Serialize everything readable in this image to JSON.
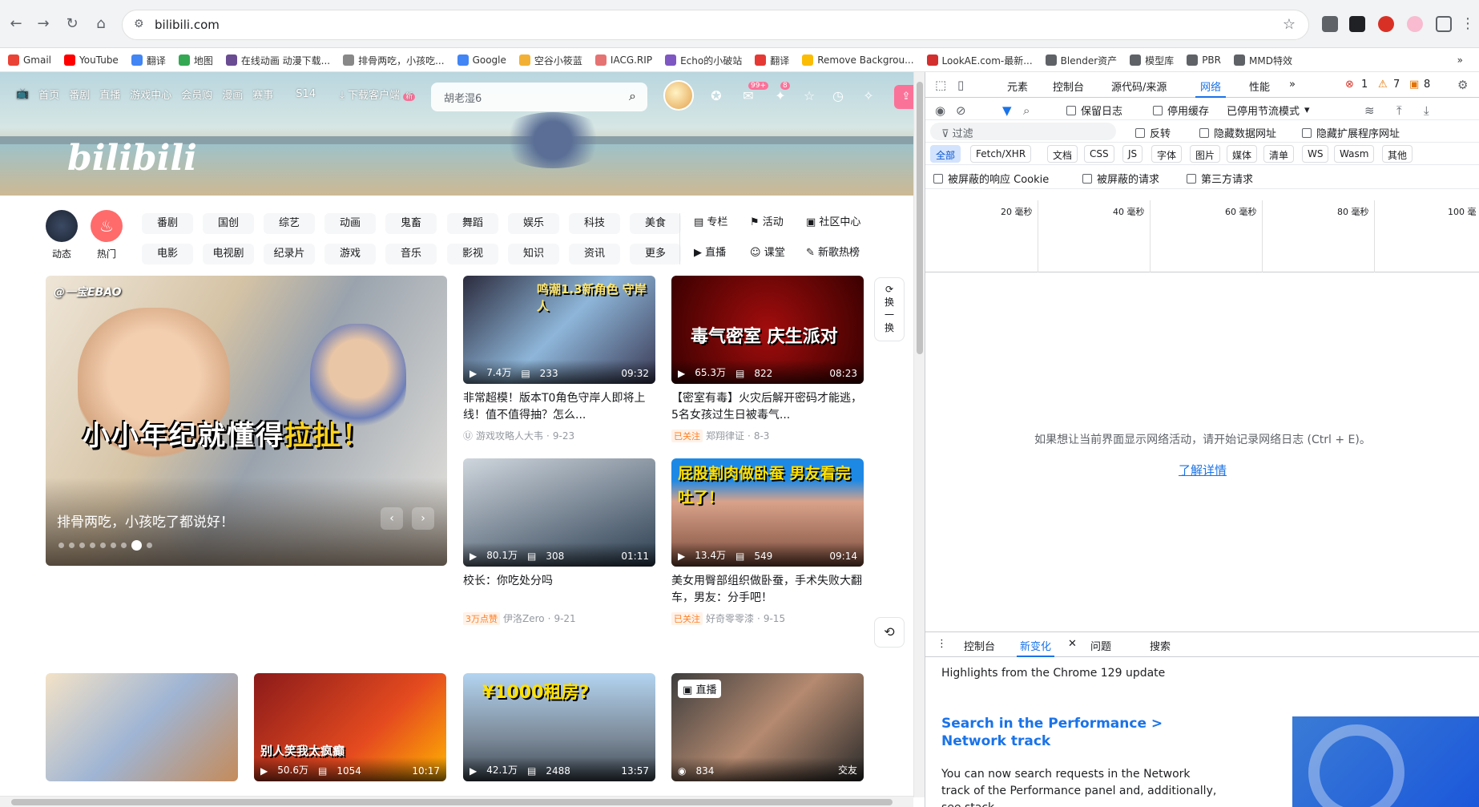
{
  "browser": {
    "url": "bilibili.com",
    "bookmarks": [
      "Gmail",
      "YouTube",
      "翻译",
      "地图",
      "在线动画 动漫下载...",
      "排骨两吃，小孩吃...",
      "Google",
      "空谷小筱蓝",
      "IACG.RIP",
      "Echo的小破站",
      "翻译",
      "Remove Backgrou...",
      "LookAE.com-最新...",
      "Blender资产",
      "模型库",
      "PBR",
      "MMD特效"
    ],
    "bookmark_colors": [
      "#ea4335",
      "#ff0000",
      "#4285f4",
      "#34a853",
      "#6a4c93",
      "#888888",
      "#4285f4",
      "#f2b134",
      "#e57373",
      "#7e57c2",
      "#e53935",
      "#fbbc04",
      "#d32f2f",
      "#5f6368",
      "#5f6368",
      "#5f6368",
      "#5f6368"
    ],
    "more_bookmarks": "»"
  },
  "header": {
    "nav": [
      "首页",
      "番剧",
      "直播",
      "游戏中心",
      "会员购",
      "漫画",
      "赛事"
    ],
    "s14": "S14",
    "download": "下载客户端",
    "new_tag": "新",
    "search_placeholder": "胡老湿6",
    "msg_badge": "99+",
    "dyn_badge": "8",
    "logo": "bilibili"
  },
  "channels": {
    "dynamic": "动态",
    "hot": "热门",
    "row1": [
      "番剧",
      "国创",
      "综艺",
      "动画",
      "鬼畜",
      "舞蹈",
      "娱乐",
      "科技",
      "美食"
    ],
    "row2": [
      "电影",
      "电视剧",
      "纪录片",
      "游戏",
      "音乐",
      "影视",
      "知识",
      "资讯",
      "更多"
    ],
    "side1": [
      "专栏",
      "活动",
      "社区中心"
    ],
    "side2": [
      "直播",
      "课堂",
      "新歌热榜"
    ]
  },
  "carousel": {
    "watermark": "@一宝EBAO",
    "overlay_main": "小小年纪就懂得",
    "overlay_em": "拉扯！",
    "caption": "排骨两吃，小孩吃了都说好！"
  },
  "refresh": {
    "line1": "换",
    "line2": "一",
    "line3": "换"
  },
  "cards": [
    {
      "overlay": "鸣潮1.3新角色 守岸人",
      "views": "7.4万",
      "danmaku": "233",
      "duration": "09:32",
      "title": "非常超模！版本T0角色守岸人即将上线！值不值得抽？怎么...",
      "tag": "",
      "author": "游戏攻略人大韦",
      "date": "9-23"
    },
    {
      "overlay": "毒气密室 庆生派对",
      "views": "65.3万",
      "danmaku": "822",
      "duration": "08:23",
      "title": "【密室有毒】火灾后解开密码才能逃，5名女孩过生日被毒气...",
      "tag": "已关注",
      "author": "郑翔律证",
      "date": "8-3"
    },
    {
      "overlay": "",
      "views": "80.1万",
      "danmaku": "308",
      "duration": "01:11",
      "title": "校长：你吃处分吗",
      "tag": "3万点赞",
      "author": "伊洛Zero",
      "date": "9-21"
    },
    {
      "overlay": "屁股割肉做卧蚕 男友看完吐了！",
      "views": "13.4万",
      "danmaku": "549",
      "duration": "09:14",
      "title": "美女用臀部组织做卧蚕，手术失败大翻车，男友：分手吧！",
      "tag": "已关注",
      "author": "好奇零零漆",
      "date": "9-15"
    }
  ],
  "row2_cards": [
    {
      "overlay": "",
      "views": "",
      "danmaku": "",
      "duration": ""
    },
    {
      "overlay": "别人笑我太疯癫",
      "views": "50.6万",
      "danmaku": "1054",
      "duration": "10:17"
    },
    {
      "overlay": "¥1000租房?",
      "views": "42.1万",
      "danmaku": "2488",
      "duration": "13:57"
    },
    {
      "overlay": "直播",
      "views": "834",
      "danmaku": "",
      "duration": "交友"
    }
  ],
  "devtools": {
    "tabs": [
      "元素",
      "控制台",
      "源代码/来源",
      "网络",
      "性能"
    ],
    "more": "»",
    "errors": "1",
    "warnings": "7",
    "issues": "8",
    "preserve_log": "保留日志",
    "disable_cache": "停用缓存",
    "throttle": "已停用节流模式",
    "filter_placeholder": "过滤",
    "invert": "反转",
    "hide_data_urls": "隐藏数据网址",
    "hide_ext_urls": "隐藏扩展程序网址",
    "types": [
      "全部",
      "Fetch/XHR",
      "文档",
      "CSS",
      "JS",
      "字体",
      "图片",
      "媒体",
      "清单",
      "WS",
      "Wasm",
      "其他"
    ],
    "blocked_cookies": "被屏蔽的响应 Cookie",
    "blocked_requests": "被屏蔽的请求",
    "third_party": "第三方请求",
    "timeline_labels": [
      "20 毫秒",
      "40 毫秒",
      "60 毫秒",
      "80 毫秒",
      "100 毫"
    ],
    "empty_message": "如果想让当前界面显示网络活动，请开始记录网络日志 (Ctrl + E)。",
    "learn_more": "了解详情",
    "drawer_tabs": [
      "控制台",
      "新变化",
      "问题",
      "搜索"
    ],
    "highlights": "Highlights from the Chrome 129 update",
    "whats_new_title": "Search in the Performance > Network track",
    "whats_new_body": "You can now search requests in the Network track of the Performance panel and, additionally, see stack"
  },
  "colors": {
    "accent": "#fb7299",
    "blue": "#1a73e8"
  }
}
